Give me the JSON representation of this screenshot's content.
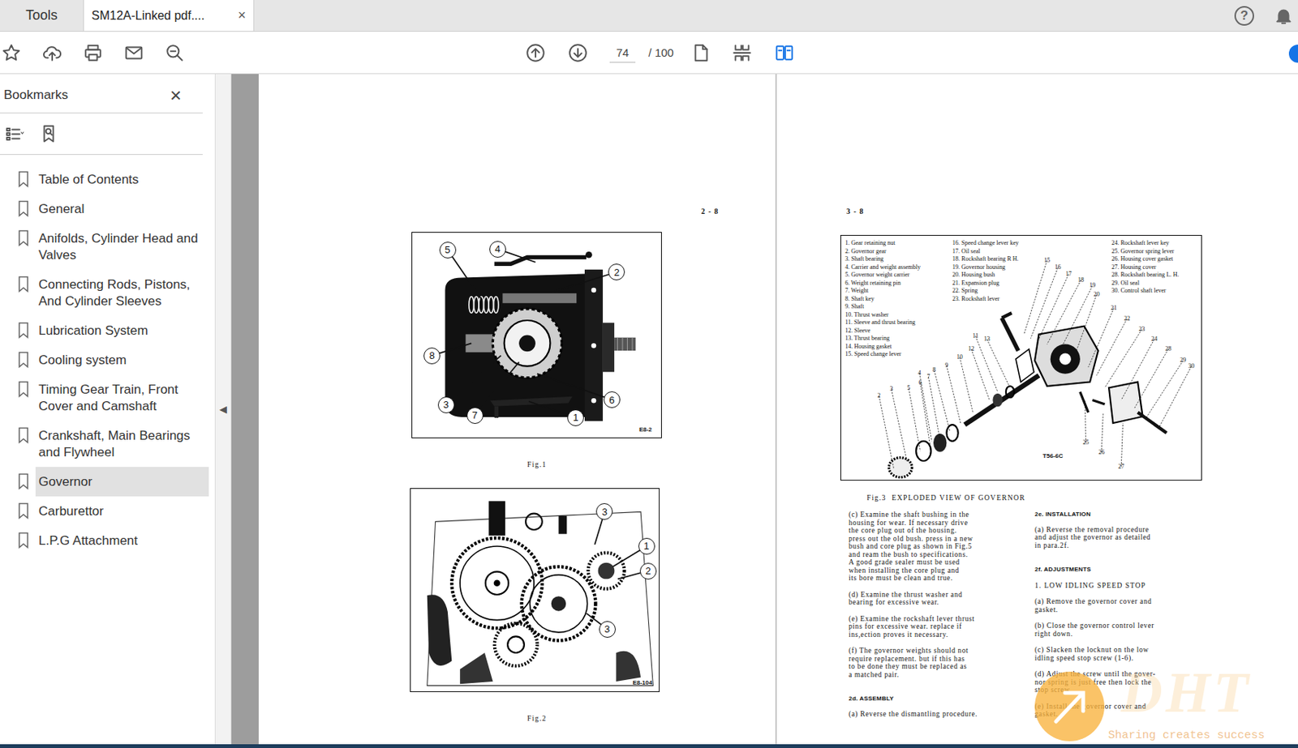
{
  "tabs": [
    {
      "label": "Tools",
      "selected": false
    },
    {
      "label": "SM12A-Linked pdf....",
      "selected": true,
      "close": "×"
    }
  ],
  "header": {
    "help": "?"
  },
  "toolbar": {
    "page": "74",
    "total": "/ 100"
  },
  "sidebar": {
    "title": "Bookmarks",
    "close": "×",
    "collapse": "◀",
    "items": [
      {
        "label": "Table of Contents",
        "selected": false
      },
      {
        "label": "General",
        "selected": false
      },
      {
        "label": "Anifolds, Cylinder Head and Valves",
        "selected": false
      },
      {
        "label": "Connecting Rods, Pistons, And Cylinder Sleeves",
        "selected": false
      },
      {
        "label": "Lubrication System",
        "selected": false
      },
      {
        "label": "Cooling system",
        "selected": false
      },
      {
        "label": "Timing Gear Train, Front Cover and Camshaft",
        "selected": false
      },
      {
        "label": "Crankshaft, Main Bearings and Flywheel",
        "selected": false
      },
      {
        "label": "Governor",
        "selected": true
      },
      {
        "label": "Carburettor",
        "selected": false
      },
      {
        "label": "L.P.G Attachment",
        "selected": false
      }
    ]
  },
  "pages": [
    {
      "number": "2 - 8",
      "figures": [
        {
          "caption": "Fig.1",
          "code": "E8-2",
          "callouts": [
            "5",
            "4",
            "2",
            "8",
            "3",
            "7",
            "6",
            "1"
          ]
        },
        {
          "caption": "Fig.2",
          "code": "E8-104",
          "callouts": [
            "3",
            "1",
            "2",
            "3"
          ]
        }
      ]
    },
    {
      "number": "3 - 8",
      "figures": [
        {
          "caption": "Fig.3  EXPLODED VIEW OF GOVERNOR",
          "code": "T56-6C",
          "legend": [
            [
              "1. Gear retaining nut",
              "2. Governor gear",
              "3. Shaft bearing",
              "4. Carrier and weight assembly",
              "5. Governor weight carrier",
              "6. Weight retaining pin",
              "7. Weight",
              "8. Shaft key",
              "9. Shaft",
              "10. Thrust washer",
              "11. Sleeve and thrust bearing",
              "12. Sleeve",
              "13. Thrust bearing",
              "14. Housing gasket",
              "15. Speed change lever"
            ],
            [
              "16. Speed change lever key",
              "17. Oil seal",
              "18. Rockshaft bearing R H.",
              "19. Governor housing",
              "20. Housing bush",
              "21. Expansion plug",
              "22. Spring",
              "23. Rockshaft lever"
            ],
            [
              "24. Rockshaft lever key",
              "25. Governor spring lever",
              "26. Housing cover gasket",
              "27. Housing cover",
              "28. Rockshaft bearing L. H.",
              "29. Oil seal",
              "30. Control shaft lever"
            ]
          ],
          "callouts": [
            "15",
            "16",
            "17",
            "18",
            "19",
            "20",
            "21",
            "22",
            "23",
            "24",
            "28",
            "29",
            "30",
            "11",
            "13",
            "12",
            "10",
            "9",
            "8",
            "7",
            "6",
            "5",
            "4",
            "3",
            "2",
            "25",
            "26",
            "27"
          ]
        }
      ],
      "columns": [
        [
          {
            "kind": "para",
            "lines": [
              "(c) Examine the shaft bushing in the",
              "housing for wear. If necessary drive",
              "the core plug out of the housing.",
              "press out the old bush. press in a new",
              "bush and core plug as shown in Fig.5",
              "and ream the bush to specifications.",
              "A good grade sealer must be used",
              "when installing the core plug and",
              "its bore must be clean and true."
            ]
          },
          {
            "kind": "para",
            "lines": [
              "(d) Examine the thrust washer and",
              "bearing for excessive wear."
            ]
          },
          {
            "kind": "para",
            "lines": [
              "(e) Examine the rockshaft lever thrust",
              "pins for excessive wear. replace if",
              "ins,ection proves it necessary."
            ]
          },
          {
            "kind": "para",
            "lines": [
              "(f) The governor weights should not",
              "require replacement. but if this has",
              "to be done they must be replaced as",
              "a matched pair."
            ]
          },
          {
            "kind": "heading",
            "lines": [
              "2d. ASSEMBLY"
            ]
          },
          {
            "kind": "para",
            "lines": [
              "(a) Reverse the dismantling procedure."
            ]
          }
        ],
        [
          {
            "kind": "heading",
            "lines": [
              "2e. INSTALLATION"
            ]
          },
          {
            "kind": "para",
            "lines": [
              "(a) Reverse the removal procedure",
              "and adjust the governor as detailed",
              "in para.2f."
            ]
          },
          {
            "kind": "heading",
            "lines": [
              "2f. ADJUSTMENTS"
            ]
          },
          {
            "kind": "sub",
            "lines": [
              "1. LOW IDLING SPEED STOP"
            ]
          },
          {
            "kind": "para",
            "lines": [
              "(a) Remove the governor cover and",
              "gasket."
            ]
          },
          {
            "kind": "para",
            "lines": [
              "(b) Close the governor control lever",
              "right down."
            ]
          },
          {
            "kind": "para",
            "lines": [
              "(c) Slacken the locknut on the low",
              "idling speed stop screw (1-6)."
            ]
          },
          {
            "kind": "para",
            "lines": [
              "(d) Adjust the screw until the gover-",
              "nor spring is just free then lock the",
              "stop screw."
            ]
          },
          {
            "kind": "para",
            "lines": [
              "(e) Install the governor cover and",
              "gasket."
            ]
          }
        ]
      ]
    }
  ],
  "watermark": {
    "logo": "DHT",
    "tagline": "Sharing creates success"
  }
}
